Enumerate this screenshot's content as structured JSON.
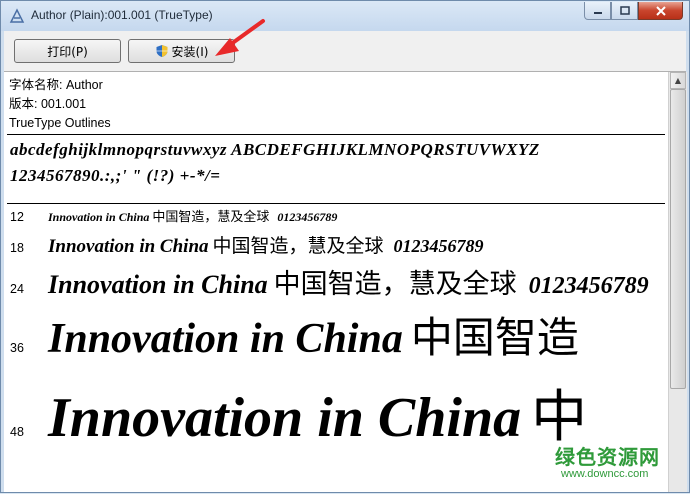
{
  "window": {
    "title": "Author (Plain):001.001 (TrueType)"
  },
  "toolbar": {
    "print_label": "打印(P)",
    "install_label": "安装(I)"
  },
  "info": {
    "font_name": "字体名称: Author",
    "version": "版本: 001.001",
    "outline": "TrueType Outlines"
  },
  "charset": {
    "line1": "abcdefghijklmnopqrstuvwxyz ABCDEFGHIJKLMNOPQRSTUVWXYZ",
    "line2": "1234567890.:,;' \" (!?) +-*/="
  },
  "samples": [
    {
      "size": "12",
      "latin": "Innovation in China",
      "cjk": "中国智造，慧及全球",
      "digits": "0123456789"
    },
    {
      "size": "18",
      "latin": "Innovation in China",
      "cjk": "中国智造，慧及全球",
      "digits": "0123456789"
    },
    {
      "size": "24",
      "latin": "Innovation in China",
      "cjk": "中国智造，慧及全球",
      "digits": "0123456789"
    },
    {
      "size": "36",
      "latin": "Innovation in China",
      "cjk": "中国智造",
      "digits": ""
    },
    {
      "size": "48",
      "latin": "Innovation in China",
      "cjk": "中",
      "digits": ""
    }
  ],
  "watermark": {
    "main": "绿色资源网",
    "sub": "www.downcc.com"
  },
  "colors": {
    "accent_arrow": "#e8292a",
    "watermark": "#2f9a3a"
  }
}
